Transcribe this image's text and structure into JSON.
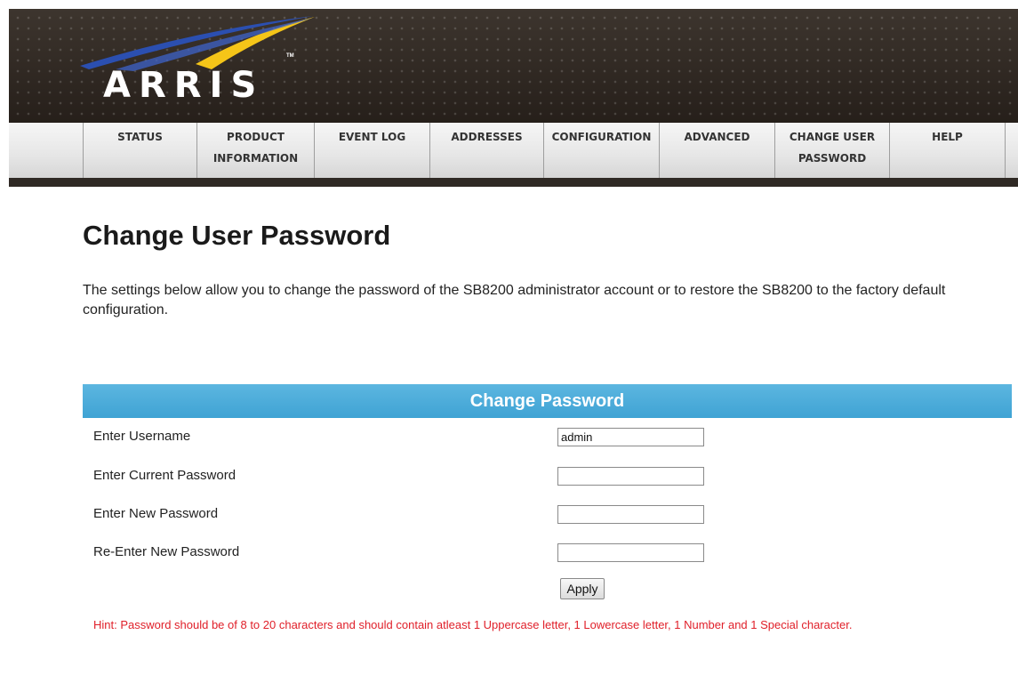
{
  "header": {
    "logo_text": "ARRIS",
    "logo_tm": "TM"
  },
  "nav": {
    "items": [
      {
        "line1": "STATUS",
        "line2": ""
      },
      {
        "line1": "PRODUCT",
        "line2": "INFORMATION"
      },
      {
        "line1": "EVENT LOG",
        "line2": ""
      },
      {
        "line1": "ADDRESSES",
        "line2": ""
      },
      {
        "line1": "CONFIGURATION",
        "line2": ""
      },
      {
        "line1": "ADVANCED",
        "line2": ""
      },
      {
        "line1": "CHANGE USER",
        "line2": "PASSWORD"
      },
      {
        "line1": "HELP",
        "line2": ""
      }
    ]
  },
  "page": {
    "title": "Change User Password",
    "intro": "The settings below allow you to change the password of the SB8200 administrator account or to restore the SB8200 to the factory default configuration."
  },
  "form": {
    "section_title": "Change Password",
    "username_label": "Enter Username",
    "username_value": "admin",
    "current_password_label": "Enter Current Password",
    "current_password_value": "",
    "new_password_label": "Enter New Password",
    "new_password_value": "",
    "reenter_password_label": "Re-Enter New Password",
    "reenter_password_value": "",
    "apply_label": "Apply",
    "hint": "Hint: Password should be of 8 to 20 characters and should contain atleast 1 Uppercase letter, 1 Lowercase letter, 1 Number and 1 Special character."
  },
  "colors": {
    "header_bg": "#2e2823",
    "accent_blue": "#4aa9d9",
    "hint_red": "#e0202a",
    "logo_swoosh_yellow": "#f5c518",
    "logo_swoosh_blue": "#2b4fb0"
  }
}
